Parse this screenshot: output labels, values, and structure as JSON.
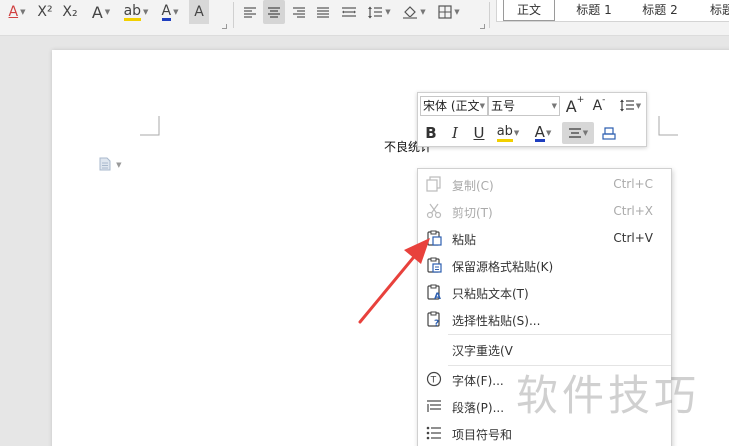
{
  "toolbar": {
    "font_color_glyph": "A",
    "superscript": "X²",
    "subscript": "X₂",
    "text_effect_glyph": "A",
    "highlight_glyph": "ab",
    "font_color2_glyph": "A",
    "char_shading_glyph": "A"
  },
  "styles": {
    "items": [
      "正文",
      "标题 1",
      "标题 2",
      "标题"
    ],
    "active_index": 0
  },
  "document": {
    "selected_text": "不良统计"
  },
  "mini_toolbar": {
    "font_name": "宋体 (正文",
    "font_size": "五号",
    "grow_font": "A",
    "shrink_font": "A",
    "bold": "B",
    "italic": "I",
    "underline": "U",
    "highlight": "ab",
    "font_color": "A"
  },
  "context_menu": {
    "items": [
      {
        "label": "复制(C)",
        "shortcut": "Ctrl+C",
        "enabled": false,
        "icon": "copy-icon"
      },
      {
        "label": "剪切(T)",
        "shortcut": "Ctrl+X",
        "enabled": false,
        "icon": "cut-icon"
      },
      {
        "label": "粘贴",
        "shortcut": "Ctrl+V",
        "enabled": true,
        "icon": "paste-icon"
      },
      {
        "label": "保留源格式粘贴(K)",
        "shortcut": "",
        "enabled": true,
        "icon": "paste-keep-format-icon"
      },
      {
        "label": "只粘贴文本(T)",
        "shortcut": "",
        "enabled": true,
        "icon": "paste-text-only-icon"
      },
      {
        "label": "选择性粘贴(S)...",
        "shortcut": "",
        "enabled": true,
        "icon": "paste-special-icon"
      },
      {
        "label": "汉字重选(V",
        "shortcut": "",
        "enabled": true,
        "icon": ""
      },
      {
        "label": "字体(F)...",
        "shortcut": "",
        "enabled": true,
        "icon": "font-icon"
      },
      {
        "label": "段落(P)...",
        "shortcut": "",
        "enabled": true,
        "icon": "paragraph-icon"
      },
      {
        "label": "项目符号和",
        "shortcut": "",
        "enabled": true,
        "icon": "bullets-icon"
      }
    ]
  },
  "watermark": "软件技巧",
  "colors": {
    "highlight_yellow": "#f2d000",
    "font_blue": "#1f3fbf",
    "arrow_red": "#e8413c",
    "accent_red": "#d9534f"
  }
}
